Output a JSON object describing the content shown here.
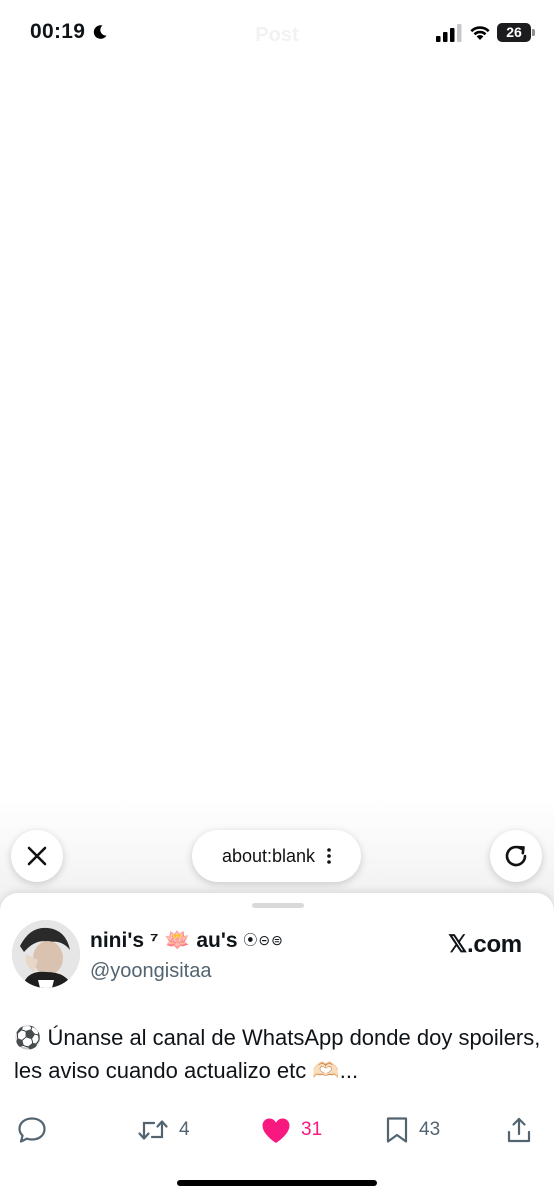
{
  "status_bar": {
    "time": "00:19",
    "page_title": "Post",
    "battery": "26"
  },
  "browser": {
    "url": "about:blank"
  },
  "tweet": {
    "display_name": "nini's ⁷ 🪷 au's",
    "badge": "⦿⊝⊜",
    "handle": "@yoongisitaa",
    "brand": "𝕏.com",
    "text": "⚽️ Únanse al canal de WhatsApp donde doy spoilers, les aviso cuando actualizo etc 🫶🏻...",
    "retweets": "4",
    "likes": "31",
    "bookmarks": "43",
    "like_color": "#f91880"
  }
}
